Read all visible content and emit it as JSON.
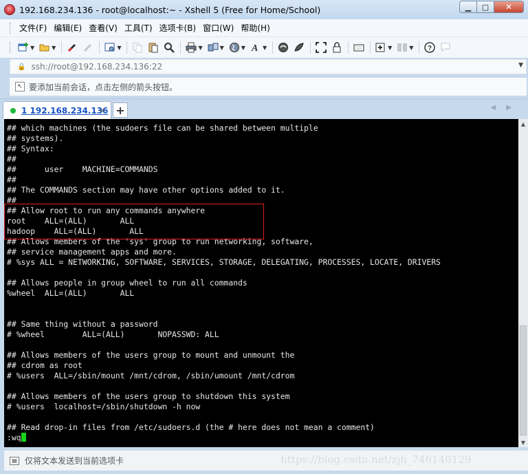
{
  "window": {
    "title": "192.168.234.136 - root@localhost:~ - Xshell 5 (Free for Home/School)",
    "min_glyph": "▁",
    "max_glyph": "▢",
    "close_glyph": "✕"
  },
  "menu": [
    "文件(F)",
    "编辑(E)",
    "查看(V)",
    "工具(T)",
    "选项卡(B)",
    "窗口(W)",
    "帮助(H)"
  ],
  "address": {
    "value": "ssh://root@192.168.234.136:22",
    "drop_glyph": "▼",
    "lock_glyph": "🔒"
  },
  "hint": {
    "text": "要添加当前会话，点击左侧的箭头按钮。"
  },
  "tabs": {
    "active_label": "1 192.168.234.136",
    "close_glyph": "×",
    "add_glyph": "+",
    "nav_glyphs": "◀ ▶"
  },
  "terminal": {
    "lines": [
      "## which machines (the sudoers file can be shared between multiple",
      "## systems).",
      "## Syntax:",
      "##",
      "##      user    MACHINE=COMMANDS",
      "##",
      "## The COMMANDS section may have other options added to it.",
      "##",
      "## Allow root to run any commands anywhere",
      "root    ALL=(ALL)       ALL",
      "hadoop    ALL=(ALL)       ALL",
      "## Allows members of the 'sys' group to run networking, software,",
      "## service management apps and more.",
      "# %sys ALL = NETWORKING, SOFTWARE, SERVICES, STORAGE, DELEGATING, PROCESSES, LOCATE, DRIVERS",
      "",
      "## Allows people in group wheel to run all commands",
      "%wheel  ALL=(ALL)       ALL",
      "",
      "",
      "## Same thing without a password",
      "# %wheel        ALL=(ALL)       NOPASSWD: ALL",
      "",
      "## Allows members of the users group to mount and unmount the",
      "## cdrom as root",
      "# %users  ALL=/sbin/mount /mnt/cdrom, /sbin/umount /mnt/cdrom",
      "",
      "## Allows members of the users group to shutdown this system",
      "# %users  localhost=/sbin/shutdown -h now",
      "",
      "## Read drop-in files from /etc/sudoers.d (the # here does not mean a comment)"
    ],
    "prompt": ":wq"
  },
  "sendbar": {
    "text": "仅将文本发送到当前选项卡"
  },
  "watermark": "https://blog.csdn.net/zjh_746140129",
  "colors": {
    "terminal_bg": "#000000",
    "terminal_fg": "#e8e8e8",
    "cursor": "#19d219",
    "highlight": "#e02020",
    "tab_text": "#1a55c4"
  }
}
